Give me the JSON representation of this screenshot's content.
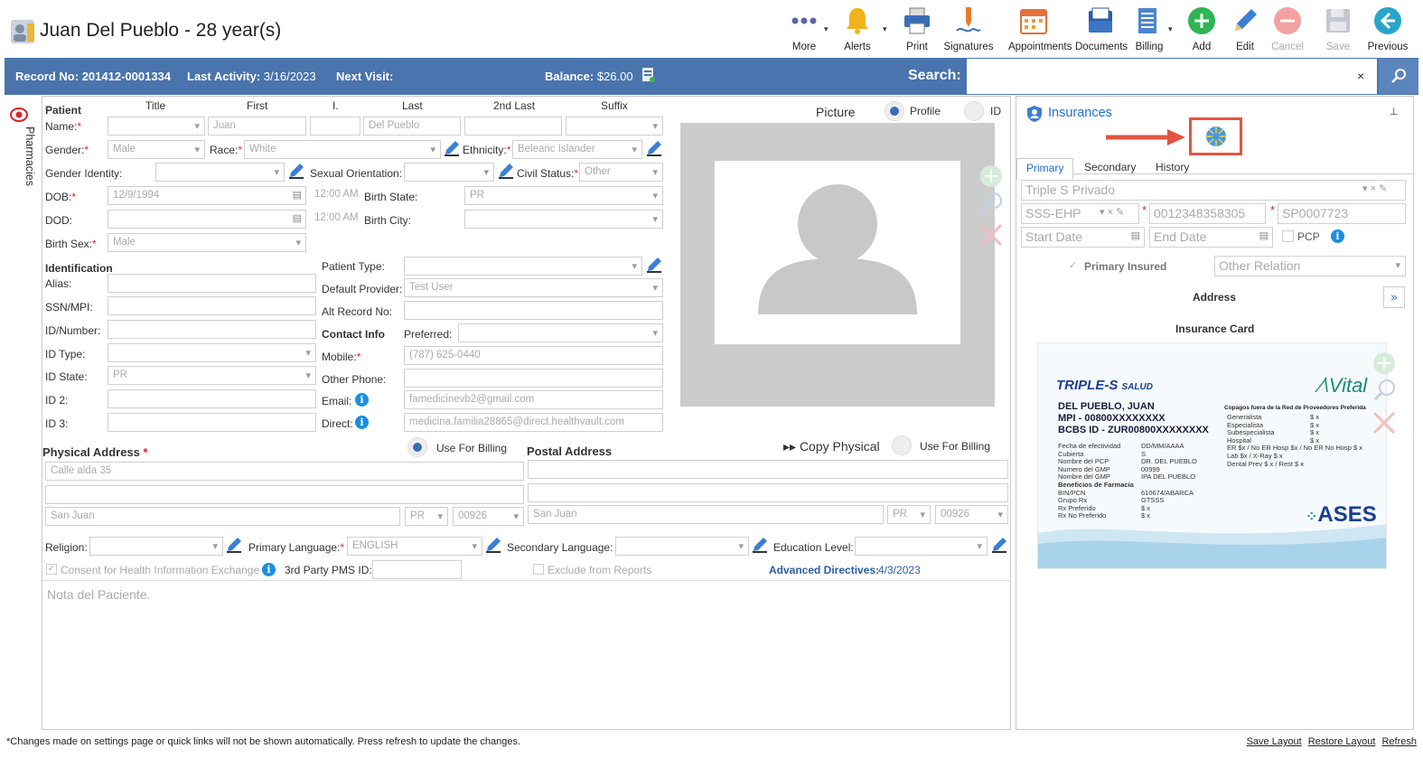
{
  "patient_title": "Juan Del Pueblo - 28 year(s)",
  "toolbar": [
    {
      "label": "More",
      "icon": "more-icon"
    },
    {
      "label": "Alerts",
      "icon": "bell-icon"
    },
    {
      "label": "Print",
      "icon": "printer-icon"
    },
    {
      "label": "Signatures",
      "icon": "pen-signature-icon"
    },
    {
      "label": "Appointments",
      "icon": "calendar-icon"
    },
    {
      "label": "Documents",
      "icon": "documents-icon"
    },
    {
      "label": "Billing",
      "icon": "billing-icon"
    },
    {
      "label": "Add",
      "icon": "plus-icon"
    },
    {
      "label": "Edit",
      "icon": "pencil-icon"
    },
    {
      "label": "Cancel",
      "icon": "minus-icon"
    },
    {
      "label": "Save",
      "icon": "floppy-icon"
    },
    {
      "label": "Previous",
      "icon": "arrow-left-icon"
    }
  ],
  "bar": {
    "record_label": "Record No:",
    "record_value": "201412-0001334",
    "activity_label": "Last Activity:",
    "activity_value": "3/16/2023",
    "next_label": "Next Visit:",
    "balance_label": "Balance:",
    "balance_value": "$26.00",
    "search_label": "Search:",
    "search_clear": "×"
  },
  "rail": {
    "label": "Pharmacies"
  },
  "form": {
    "col_headers": {
      "patient": "Patient",
      "title": "Title",
      "first": "First",
      "i": "I.",
      "last": "Last",
      "last2": "2nd Last",
      "suffix": "Suffix"
    },
    "name_label": "Name:",
    "first_value": "Juan",
    "last_value": "Del Pueblo",
    "gender_label": "Gender:",
    "gender_value": "Male",
    "race_label": "Race:",
    "race_value": "White",
    "ethnicity_label": "Ethnicity:",
    "ethnicity_value": "Belearic Islander",
    "gender_identity_label": "Gender Identity:",
    "sexual_orientation_label": "Sexual Orientation:",
    "civil_status_label": "Civil Status:",
    "civil_status_value": "Other",
    "dob_label": "DOB:",
    "dob_value": "12/9/1994",
    "time_value": "12:00 AM",
    "birth_state_label": "Birth State:",
    "birth_state_value": "PR",
    "dod_label": "DOD:",
    "dod_time_value": "12:00 AM",
    "birth_city_label": "Birth City:",
    "birth_sex_label": "Birth Sex:",
    "birth_sex_value": "Male",
    "identification_header": "Identification",
    "alias_label": "Alias:",
    "ssn_label": "SSN/MPI:",
    "idnumber_label": "ID/Number:",
    "idtype_label": "ID Type:",
    "idstate_label": "ID State:",
    "idstate_value": "PR",
    "id2_label": "ID 2:",
    "id3_label": "ID 3:",
    "patient_type_label": "Patient Type:",
    "default_provider_label": "Default Provider:",
    "default_provider_value": "Test User",
    "alt_record_label": "Alt Record No:",
    "contact_info_header": "Contact Info",
    "preferred_label": "Preferred:",
    "mobile_label": "Mobile:",
    "mobile_value": "(787) 625-0440",
    "other_phone_label": "Other Phone:",
    "email_label": "Email:",
    "email_value": "famedicinevb2@gmail.com",
    "direct_label": "Direct:",
    "direct_value": "medicina.familia28865@direct.healthvault.com",
    "picture_label": "Picture",
    "profile_label": "Profile",
    "id_label": "ID",
    "physical_address_header": "Physical Address",
    "use_for_billing": "Use For Billing",
    "postal_address_header": "Postal Address",
    "copy_physical": "▸▸ Copy Physical",
    "phys_line1": "Calle alda 35",
    "phys_city": "San Juan",
    "phys_state": "PR",
    "phys_zip": "00926",
    "postal_city": "San Juan",
    "postal_state": "PR",
    "postal_zip": "00926",
    "religion_label": "Religion:",
    "primary_language_label": "Primary Language:",
    "primary_language_value": "ENGLISH",
    "secondary_language_label": "Secondary Language:",
    "education_label": "Education Level:",
    "consent_label": "Consent for Health Information Exchange",
    "third_party_label": "3rd Party PMS ID:",
    "exclude_label": "Exclude from Reports",
    "adv_dir_label": "Advanced Directives:",
    "adv_dir_value": "4/3/2023",
    "note_placeholder": "Nota del Paciente."
  },
  "insurance": {
    "title": "Insurances",
    "tabs": [
      "Primary",
      "Secondary",
      "History"
    ],
    "plan_value": "Triple S Privado",
    "subplan_value": "SSS-EHP",
    "member_value": "0012348358305",
    "group_value": "SP0007723",
    "start_placeholder": "Start Date",
    "end_placeholder": "End Date",
    "pcp_label": "PCP",
    "primary_insured_label": "Primary Insured",
    "other_relation_placeholder": "Other Relation",
    "address_label": "Address",
    "card_label": "Insurance Card",
    "card": {
      "brand": "TRIPLE-S",
      "brand_sub": "SALUD",
      "vital": "Vital",
      "name": "DEL PUEBLO, JUAN",
      "mpi": "MPI - 00800XXXXXXXX",
      "bcbs": "BCBS ID - ZUR00800XXXXXXXX",
      "left_rows": [
        [
          "Fecha de efectividad",
          "DD/MM/AAAA"
        ],
        [
          "Cubierta",
          "S"
        ],
        [
          "Nombre del PCP",
          "DR. DEL PUEBLO"
        ],
        [
          "Numero del GMP",
          "00999"
        ],
        [
          "Nombre del GMP",
          "IPA DEL PUEBLO"
        ],
        [
          "Beneficios de Farmacia",
          ""
        ],
        [
          "BIN/PCN",
          "610674/ABARCA"
        ],
        [
          "Grupo Rx",
          "GTSSS"
        ],
        [
          "Rx Preferido",
          "$ x"
        ],
        [
          "Rx No Preferido",
          "$ x"
        ]
      ],
      "copay_header": "Copagos fuera de la Red de Proveedores Preferida",
      "right_rows": [
        [
          "Generalista",
          "$ x"
        ],
        [
          "Especialista",
          "$ x"
        ],
        [
          "Subespecialista",
          "$ x"
        ],
        [
          "Hospital",
          "$ x"
        ],
        [
          "ER $x / No ER Hosp $x / No ER No Hosp $ x",
          ""
        ],
        [
          "Lab $x / X-Ray $ x",
          ""
        ],
        [
          "Dental Prev $ x / Rest $ x",
          ""
        ]
      ],
      "ases": "ASES"
    }
  },
  "footer": {
    "note": "*Changes made on settings page or quick links will not be shown automatically. Press refresh to update the changes.",
    "save_layout": "Save Layout",
    "restore_layout": "Restore Layout",
    "refresh": "Refresh"
  }
}
